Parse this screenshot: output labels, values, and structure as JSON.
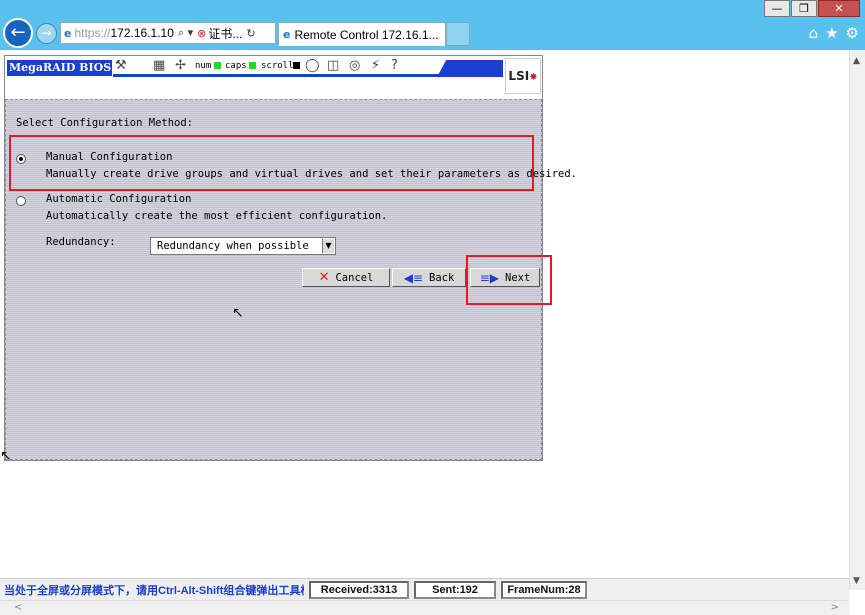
{
  "browser": {
    "address_scheme": "https://",
    "address_host": "172.16.1.10",
    "address_search_symbol": "⌕ ▾",
    "cert_error_label": "证书...",
    "tab_title": "Remote Control 172.16.1...",
    "window_buttons": {
      "minimize": "—",
      "restore": "❐",
      "close": "✕"
    }
  },
  "kvm_toolbar": {
    "title": "MegaRAID BIOS Co",
    "num_label": "num",
    "caps_label": "caps",
    "scroll_label": "scroll",
    "logo": "LSI",
    "help_symbol": "?"
  },
  "config": {
    "heading": "Select Configuration Method:",
    "manual_label": "Manual Configuration",
    "manual_desc": "Manually create drive groups and virtual drives and set their parameters as desired.",
    "manual_selected": true,
    "auto_label": "Automatic Configuration",
    "auto_desc": "Automatically create the most efficient configuration.",
    "redundancy_label": "Redundancy:",
    "redundancy_value": "Redundancy when possible",
    "cancel_label": "Cancel",
    "back_label": "Back",
    "next_label": "Next"
  },
  "statusbar": {
    "message": "当处于全屏或分屏模式下，请用Ctrl-Alt-Shift组合键弹出工具栏",
    "received": "Received:3313",
    "sent": "Sent:192",
    "frames": "FrameNum:28"
  },
  "colors": {
    "accent_blue": "#1a3fd0",
    "highlight_red": "#e01b24",
    "chrome_blue": "#58c1ed"
  }
}
